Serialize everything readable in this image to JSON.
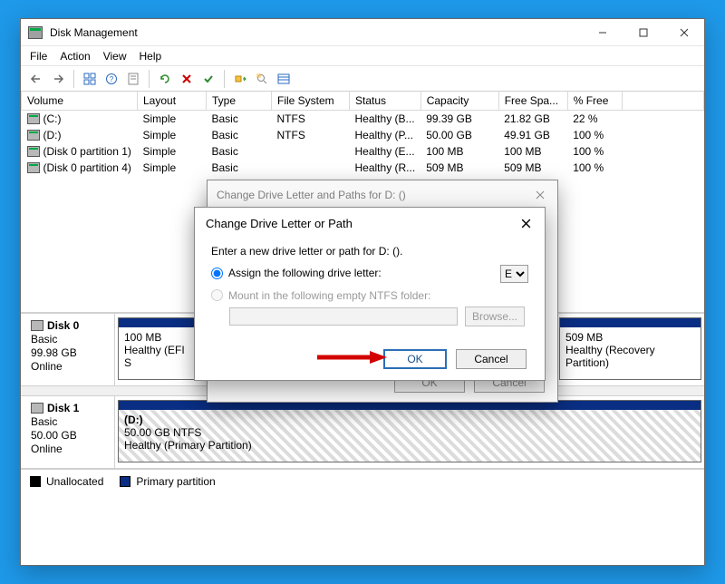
{
  "window": {
    "title": "Disk Management",
    "menu": {
      "file": "File",
      "action": "Action",
      "view": "View",
      "help": "Help"
    }
  },
  "volumes": {
    "headers": {
      "volume": "Volume",
      "layout": "Layout",
      "type": "Type",
      "filesystem": "File System",
      "status": "Status",
      "capacity": "Capacity",
      "freespace": "Free Spa...",
      "pctfree": "% Free"
    },
    "rows": [
      {
        "volume": "(C:)",
        "layout": "Simple",
        "type": "Basic",
        "fs": "NTFS",
        "status": "Healthy (B...",
        "capacity": "99.39 GB",
        "free": "21.82 GB",
        "pct": "22 %"
      },
      {
        "volume": "(D:)",
        "layout": "Simple",
        "type": "Basic",
        "fs": "NTFS",
        "status": "Healthy (P...",
        "capacity": "50.00 GB",
        "free": "49.91 GB",
        "pct": "100 %"
      },
      {
        "volume": "(Disk 0 partition 1)",
        "layout": "Simple",
        "type": "Basic",
        "fs": "",
        "status": "Healthy (E...",
        "capacity": "100 MB",
        "free": "100 MB",
        "pct": "100 %"
      },
      {
        "volume": "(Disk 0 partition 4)",
        "layout": "Simple",
        "type": "Basic",
        "fs": "",
        "status": "Healthy (R...",
        "capacity": "509 MB",
        "free": "509 MB",
        "pct": "100 %"
      }
    ]
  },
  "disks": [
    {
      "name": "Disk 0",
      "type": "Basic",
      "size": "99.98 GB",
      "status": "Online",
      "parts": [
        {
          "label1": "100 MB",
          "label2": "Healthy (EFI S",
          "widthPct": 12
        },
        {
          "label1": "",
          "label2": "",
          "widthPct": 64,
          "hidden": true
        },
        {
          "label1": "509 MB",
          "label2": "Healthy (Recovery Partition)",
          "widthPct": 24
        }
      ]
    },
    {
      "name": "Disk 1",
      "type": "Basic",
      "size": "50.00 GB",
      "status": "Online",
      "parts": [
        {
          "label0": "(D:)",
          "label1": "50.00 GB NTFS",
          "label2": "Healthy (Primary Partition)",
          "widthPct": 100,
          "hatched": true
        }
      ]
    }
  ],
  "legend": {
    "unalloc": "Unallocated",
    "primary": "Primary partition"
  },
  "dialog_back": {
    "title": "Change Drive Letter and Paths for D: ()",
    "ok": "OK",
    "cancel": "Cancel"
  },
  "dialog_front": {
    "title": "Change Drive Letter or Path",
    "instruction": "Enter a new drive letter or path for D: ().",
    "assign_label": "Assign the following drive letter:",
    "mount_label": "Mount in the following empty NTFS folder:",
    "selected_letter": "E",
    "browse": "Browse...",
    "ok": "OK",
    "cancel": "Cancel"
  }
}
